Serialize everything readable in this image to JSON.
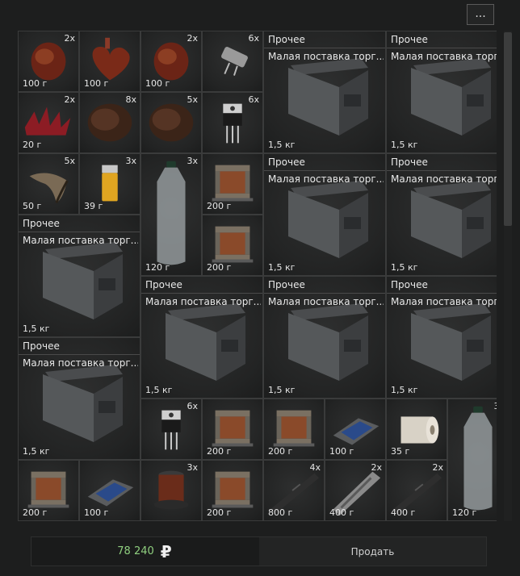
{
  "menu": {
    "label": "..."
  },
  "grid": {
    "category": "Прочее",
    "box_name": "Малая поставка торг..."
  },
  "items": [
    {
      "id": "kidney-1",
      "count": "2x",
      "weight": "100 г",
      "icon": "organ-icon"
    },
    {
      "id": "heart",
      "count": "",
      "weight": "100 г",
      "icon": "heart-icon"
    },
    {
      "id": "kidney-2",
      "count": "2x",
      "weight": "100 г",
      "icon": "organ-icon"
    },
    {
      "id": "crystal-oscillator",
      "count": "6x",
      "weight": "",
      "icon": "oscillator-icon"
    },
    {
      "id": "red-spikes",
      "count": "2x",
      "weight": "20 г",
      "icon": "spikes-icon"
    },
    {
      "id": "fur-1",
      "count": "8x",
      "weight": "",
      "icon": "fur-icon"
    },
    {
      "id": "fur-2",
      "count": "5x",
      "weight": "",
      "icon": "fur-icon"
    },
    {
      "id": "transistor-1",
      "count": "6x",
      "weight": "",
      "icon": "transistor-icon"
    },
    {
      "id": "claw",
      "count": "5x",
      "weight": "50 г",
      "icon": "claw-icon"
    },
    {
      "id": "lighter",
      "count": "3x",
      "weight": "39 г",
      "icon": "lighter-icon"
    },
    {
      "id": "bottle-1",
      "count": "3x",
      "weight": "120 г",
      "icon": "bottle-icon"
    },
    {
      "id": "transformer-1",
      "count": "",
      "weight": "200 г",
      "icon": "transformer-icon"
    },
    {
      "id": "transformer-2",
      "count": "",
      "weight": "200 г",
      "icon": "transformer-icon"
    },
    {
      "id": "transistor-2",
      "count": "6x",
      "weight": "",
      "icon": "transistor-icon"
    },
    {
      "id": "transformer-3",
      "count": "",
      "weight": "200 г",
      "icon": "transformer-icon"
    },
    {
      "id": "transformer-4",
      "count": "",
      "weight": "200 г",
      "icon": "transformer-icon"
    },
    {
      "id": "solar-panel-1",
      "count": "",
      "weight": "100 г",
      "icon": "solar-panel-icon"
    },
    {
      "id": "paper-roll",
      "count": "",
      "weight": "35 г",
      "icon": "paper-roll-icon"
    },
    {
      "id": "bottle-2",
      "count": "3x",
      "weight": "120 г",
      "icon": "bottle-icon"
    },
    {
      "id": "transformer-5",
      "count": "",
      "weight": "200 г",
      "icon": "transformer-icon"
    },
    {
      "id": "solar-panel-2",
      "count": "",
      "weight": "100 г",
      "icon": "solar-panel-icon"
    },
    {
      "id": "coil",
      "count": "3x",
      "weight": "",
      "icon": "coil-icon"
    },
    {
      "id": "transformer-6",
      "count": "",
      "weight": "200 г",
      "icon": "transformer-icon"
    },
    {
      "id": "rod-1",
      "count": "4x",
      "weight": "800 г",
      "icon": "rod-icon"
    },
    {
      "id": "bracket",
      "count": "2x",
      "weight": "400 г",
      "icon": "bracket-icon"
    },
    {
      "id": "rod-2",
      "count": "2x",
      "weight": "400 г",
      "icon": "rod-icon"
    }
  ],
  "boxes": [
    {
      "weight": "1,5 кг"
    },
    {
      "weight": "1,5 кг"
    },
    {
      "weight": "1,5 кг"
    },
    {
      "weight": "1,5 кг"
    },
    {
      "weight": "1,5 кг"
    },
    {
      "weight": "1,5 кг"
    },
    {
      "weight": "1,5 кг"
    },
    {
      "weight": "1,5 кг"
    },
    {
      "weight": "1,5 кг"
    }
  ],
  "footer": {
    "total": "78 240",
    "currency": "₽",
    "sell_label": "Продать"
  },
  "colors": {
    "total_green": "#8fcf7f",
    "background": "#1d1e1e"
  }
}
